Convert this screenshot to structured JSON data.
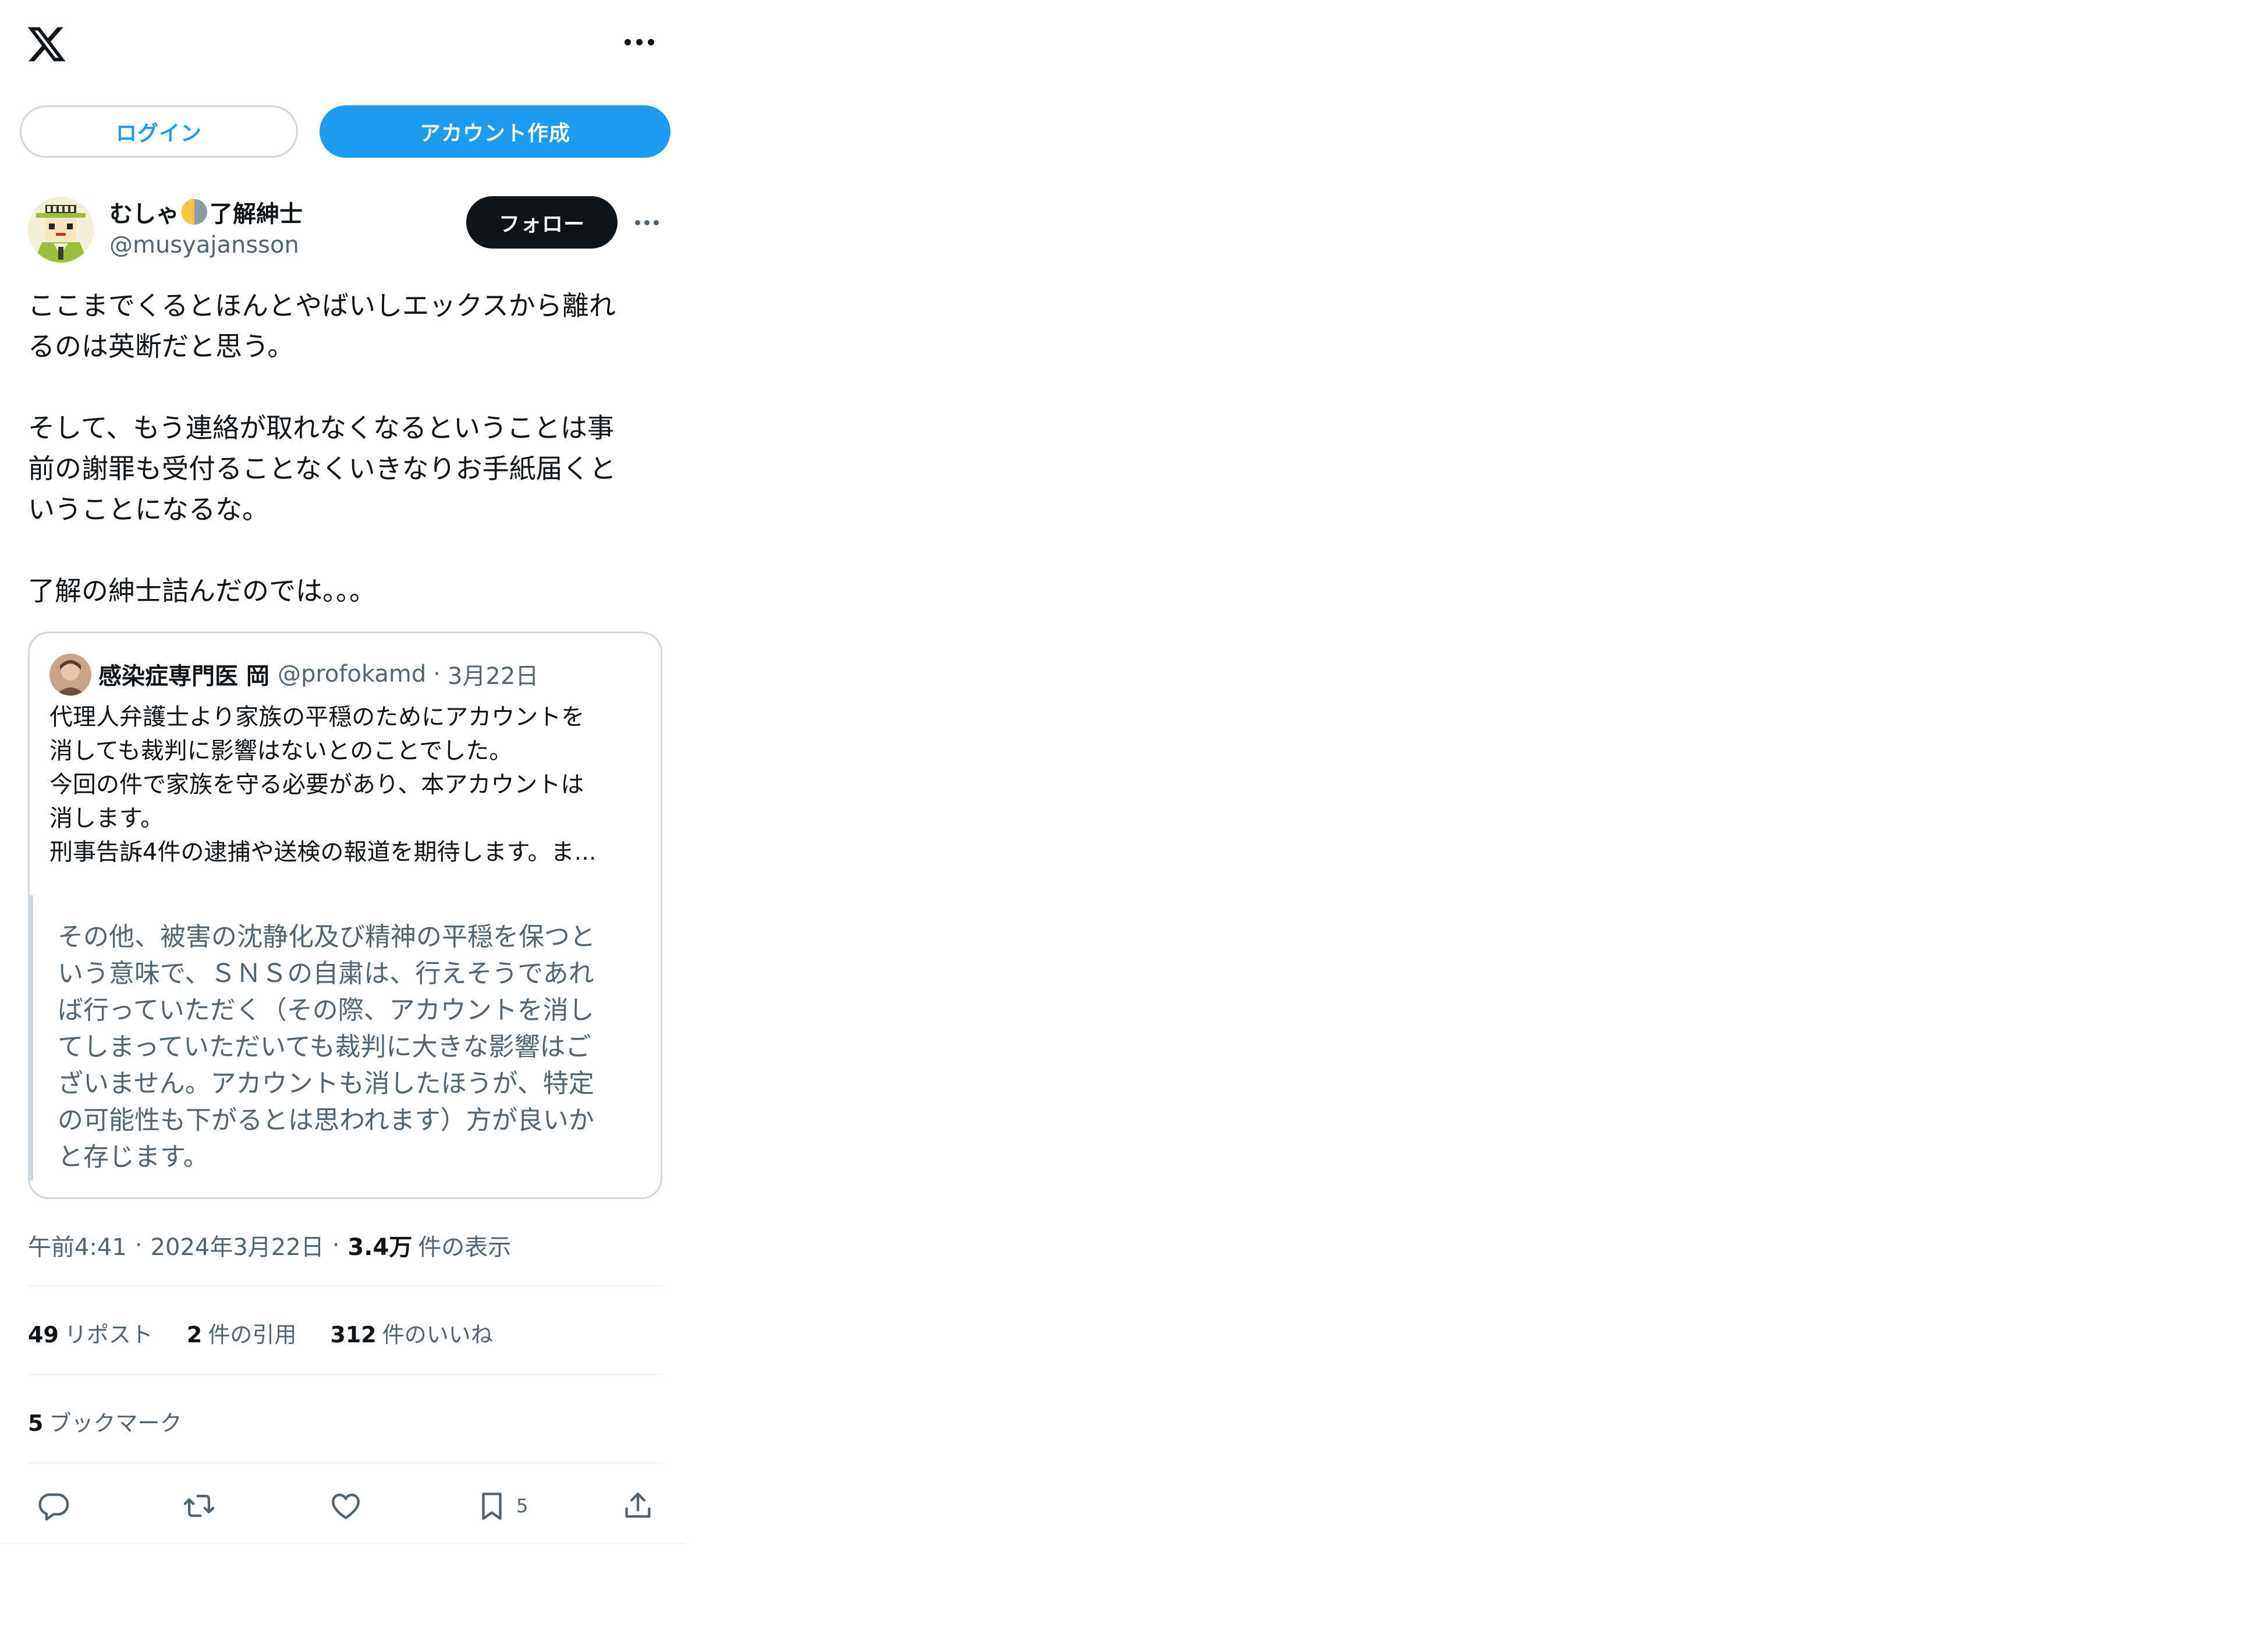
{
  "header": {
    "logo_icon": "x-logo-icon",
    "more_icon": "more-horizontal-icon"
  },
  "auth": {
    "login_label": "ログイン",
    "signup_label": "アカウント作成"
  },
  "post": {
    "author": {
      "name_before": "むしゃ",
      "name_after": "了解紳士",
      "name_emoji_icon": "half-moon-emoji-icon",
      "handle": "@musyajansson",
      "avatar_icon": "cartoon-character-avatar"
    },
    "follow_label": "フォロー",
    "text_lines": [
      "ここまでくるとほんとやばいしエックスから離れ",
      "るのは英断だと思う。",
      "",
      "そして、もう連絡が取れなくなるということは事",
      "前の謝罪も受付ることなくいきなりお手紙届くと",
      "いうことになるな。",
      "",
      "了解の紳士詰んだのでは。。。"
    ],
    "quote": {
      "name": "感染症専門医 岡",
      "handle": "@profokamd",
      "separator": "·",
      "date": "3月22日",
      "text_lines": [
        "代理人弁護士より家族の平穏のためにアカウントを",
        "消しても裁判に影響はないとのことでした。",
        "今回の件で家族を守る必要があり、本アカウントは",
        "消します。",
        "刑事告訴4件の逮捕や送検の報道を期待します。ま..."
      ],
      "blockquote_lines": [
        "その他、被害の沈静化及び精神の平穏を保つと",
        "いう意味で、ＳＮＳの自粛は、行えそうであれ",
        "ば行っていただく（その際、アカウントを消し",
        "てしまっていただいても裁判に大きな影響はご",
        "ざいません。アカウントも消したほうが、特定",
        "の可能性も下がるとは思われます）方が良いか",
        "と存じます。"
      ]
    },
    "meta": {
      "time": "午前4:41",
      "separator": "·",
      "date": "2024年3月22日",
      "views_count": "3.4万",
      "views_label": "件の表示"
    },
    "stats": {
      "reposts_count": "49",
      "reposts_label": "リポスト",
      "quotes_count": "2",
      "quotes_label": "件の引用",
      "likes_count": "312",
      "likes_label": "件のいいね",
      "bookmarks_count": "5",
      "bookmarks_label": "ブックマーク"
    },
    "actions": {
      "reply_icon": "reply-icon",
      "repost_icon": "repost-icon",
      "like_icon": "heart-icon",
      "bookmark_icon": "bookmark-icon",
      "bookmark_count": "5",
      "share_icon": "share-icon"
    }
  },
  "colors": {
    "accent": "#1d9bf0",
    "text": "#0f1419",
    "secondary": "#536471",
    "border": "#cfd9de"
  }
}
